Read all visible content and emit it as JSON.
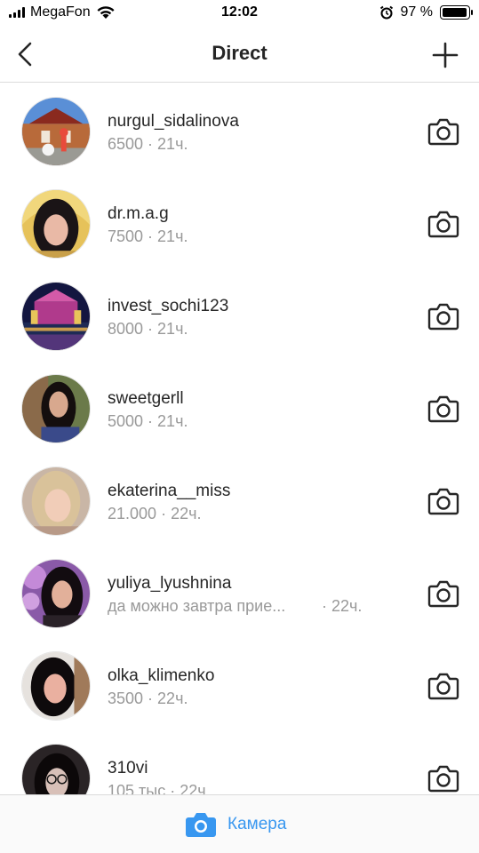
{
  "status_bar": {
    "carrier": "MegaFon",
    "time": "12:02",
    "battery_percent": "97 %",
    "battery_level": 0.97,
    "icons": [
      "signal-icon",
      "wifi-icon",
      "alarm-icon",
      "battery-icon"
    ]
  },
  "nav": {
    "title": "Direct",
    "back_icon": "chevron-left-icon",
    "new_message_icon": "plus-icon"
  },
  "threads": [
    {
      "username": "nurgul_sidalinova",
      "subtitle": "6500",
      "time": "21ч."
    },
    {
      "username": "dr.m.a.g",
      "subtitle": "7500",
      "time": "21ч."
    },
    {
      "username": "invest_sochi123",
      "subtitle": "8000",
      "time": "21ч."
    },
    {
      "username": "sweetgerll",
      "subtitle": "5000",
      "time": "21ч."
    },
    {
      "username": "ekaterina__miss",
      "subtitle": "21.000",
      "time": "22ч."
    },
    {
      "username": "yuliya_lyushnina",
      "subtitle": "да можно завтра прие...",
      "time": "22ч."
    },
    {
      "username": "olka_klimenko",
      "subtitle": "3500",
      "time": "22ч."
    },
    {
      "username": "310vi",
      "subtitle": "105 тыс",
      "time": "22ч."
    }
  ],
  "bottom_bar": {
    "camera_label": "Камера",
    "accent_color": "#3897f0"
  },
  "separator": "·"
}
